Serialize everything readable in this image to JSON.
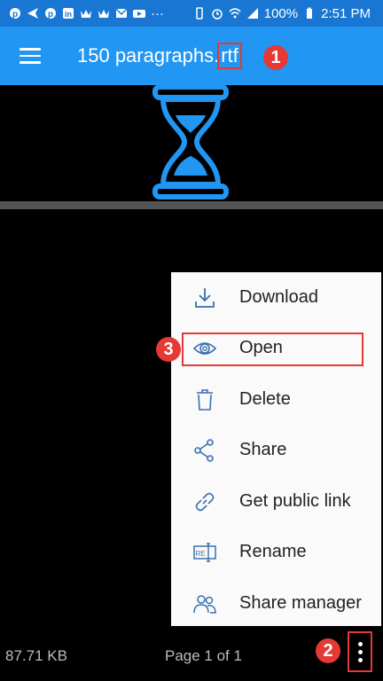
{
  "status_bar": {
    "battery": "100%",
    "time": "2:51 PM",
    "dots": "···"
  },
  "topbar": {
    "title_name": "150 paragraphs.",
    "title_ext": "rtf"
  },
  "annotations": {
    "badge1": "1",
    "badge2": "2",
    "badge3": "3"
  },
  "footer": {
    "file_size": "87.71 KB",
    "page_info": "Page 1 of 1"
  },
  "menu": {
    "items": [
      {
        "label": "Download",
        "icon": "download-icon"
      },
      {
        "label": "Open",
        "icon": "eye-icon"
      },
      {
        "label": "Delete",
        "icon": "trash-icon"
      },
      {
        "label": "Share",
        "icon": "share-icon"
      },
      {
        "label": "Get public link",
        "icon": "link-icon"
      },
      {
        "label": "Rename",
        "icon": "rename-icon"
      },
      {
        "label": "Share manager",
        "icon": "users-icon"
      }
    ]
  },
  "colors": {
    "app_bar": "#2196f3",
    "status_bar": "#1976d2",
    "accent": "#2196f3",
    "annotation": "#e53935"
  }
}
